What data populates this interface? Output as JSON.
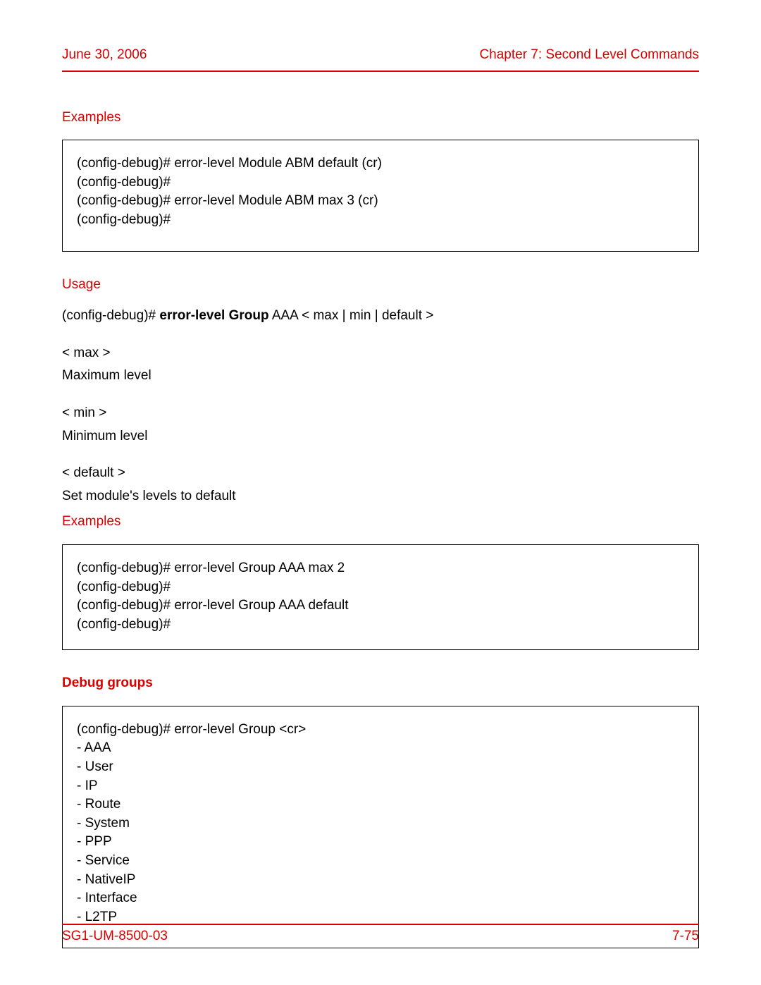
{
  "header": {
    "left": "June 30, 2006",
    "right": "Chapter 7: Second Level Commands"
  },
  "footer": {
    "left": "SG1-UM-8500-03",
    "right": "7-75"
  },
  "sections": {
    "examples1_hdr": "Examples",
    "examples1_box": "(config-debug)# error-level Module ABM default (cr)\n(config-debug)#\n(config-debug)# error-level Module ABM max 3 (cr)\n(config-debug)#",
    "usage_hdr": "Usage",
    "usage_prefix": "(config-debug)# ",
    "usage_bold": "error-level Group",
    "usage_suffix": " AAA < max | min | default >",
    "opt_max_hdr": "< max >",
    "opt_max_txt": "Maximum level",
    "opt_min_hdr": "< min >",
    "opt_min_txt": "Minimum level",
    "opt_def_hdr": "< default >",
    "opt_def_txt": "Set module's levels to default",
    "examples2_hdr": "Examples",
    "examples2_box": "(config-debug)# error-level Group AAA max 2\n(config-debug)#\n(config-debug)# error-level Group AAA default\n(config-debug)#",
    "debug_groups_hdr": "Debug groups",
    "debug_groups_box": "(config-debug)# error-level Group <cr>\n   - AAA\n   - User\n   - IP\n   - Route\n   - System\n   - PPP\n   - Service\n   - NativeIP\n   - Interface\n   - L2TP"
  }
}
